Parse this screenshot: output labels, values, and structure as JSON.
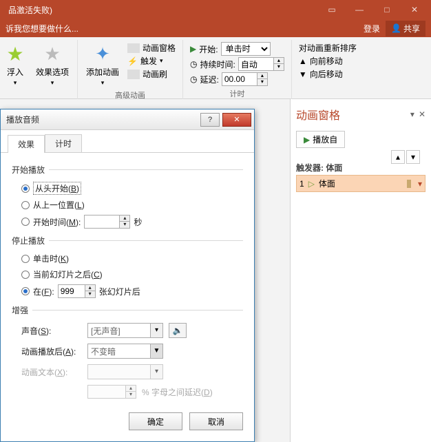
{
  "title_suffix": "品激活失败)",
  "tell_me": "诉我您想要做什么...",
  "login": "登录",
  "share": "共享",
  "ribbon": {
    "float_in": "浮入",
    "effect_opts": "效果选项",
    "add_anim": "添加动画",
    "anim_pane": "动画窗格",
    "trigger": "触发",
    "anim_painter": "动画刷",
    "group_adv": "高级动画",
    "start_lbl": "开始:",
    "start_val": "单击时",
    "duration_lbl": "持续时间:",
    "duration_val": "自动",
    "delay_lbl": "延迟:",
    "delay_val": "00.00",
    "group_timing": "计时",
    "reorder": "对动画重新排序",
    "move_fwd": "向前移动",
    "move_back": "向后移动"
  },
  "pane": {
    "title": "动画窗格",
    "play_from": "播放自",
    "trig_lbl": "触发器: 体面",
    "item_no": "1",
    "item_name": "体面"
  },
  "dlg": {
    "title": "播放音频",
    "tab_effect": "效果",
    "tab_timing": "计时",
    "fs_start": "开始播放",
    "r_begin": "从头开始(B)",
    "r_last": "从上一位置(L)",
    "r_start_time": "开始时间(M):",
    "sec": "秒",
    "fs_stop": "停止播放",
    "r_click": "单击时(K)",
    "r_after_cur": "当前幻灯片之后(C)",
    "r_at": "在(F):",
    "at_val": "999",
    "slides_after": "张幻灯片后",
    "fs_enh": "增强",
    "sound_lbl": "声音(S):",
    "sound_val": "[无声音]",
    "after_lbl": "动画播放后(A):",
    "after_val": "不变暗",
    "text_lbl": "动画文本(X):",
    "letter_delay": "% 字母之间延迟(D)",
    "ok": "确定",
    "cancel": "取消"
  }
}
